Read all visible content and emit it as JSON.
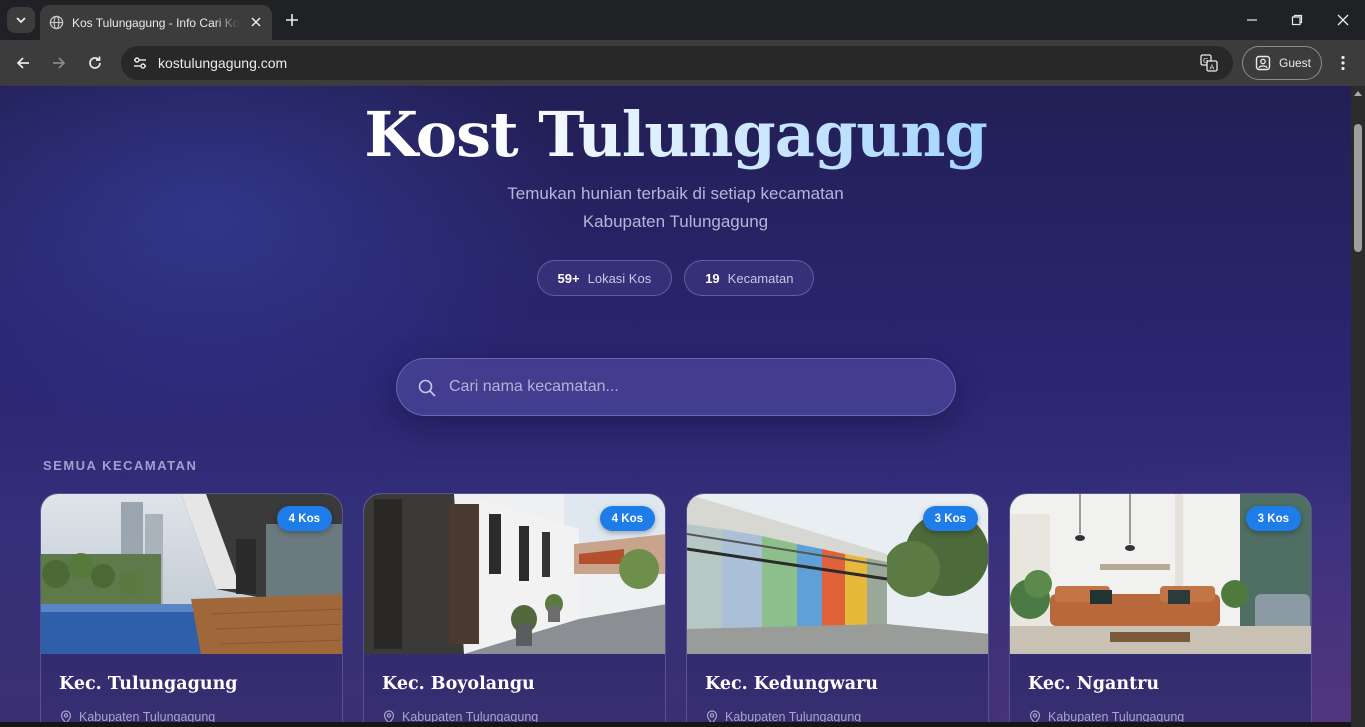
{
  "browser": {
    "tab_title": "Kos Tulungagung - Info Cari Kos",
    "url": "kostulungagung.com",
    "profile_label": "Guest"
  },
  "hero": {
    "title": "Kost Tulungagung",
    "subtitle_line1": "Temukan hunian terbaik di setiap kecamatan",
    "subtitle_line2": "Kabupaten Tulungagung"
  },
  "stats": [
    {
      "value": "59+",
      "label": "Lokasi Kos"
    },
    {
      "value": "19",
      "label": "Kecamatan"
    }
  ],
  "search": {
    "placeholder": "Cari nama kecamatan..."
  },
  "section_label": "SEMUA KECAMATAN",
  "cards": [
    {
      "title": "Kec. Tulungagung",
      "badge": "4 Kos",
      "location": "Kabupaten Tulungagung",
      "image": "poolside building"
    },
    {
      "title": "Kec. Boyolangu",
      "badge": "4 Kos",
      "location": "Kabupaten Tulungagung",
      "image": "white corridor houses"
    },
    {
      "title": "Kec. Kedungwaru",
      "badge": "3 Kos",
      "location": "Kabupaten Tulungagung",
      "image": "colorful row houses"
    },
    {
      "title": "Kec. Ngantru",
      "badge": "3 Kos",
      "location": "Kabupaten Tulungagung",
      "image": "living room interior"
    }
  ],
  "colors": {
    "badge": "#1e7de9",
    "title_gradient_end": "#7cc1ff",
    "page_bg": "#2a2672"
  }
}
